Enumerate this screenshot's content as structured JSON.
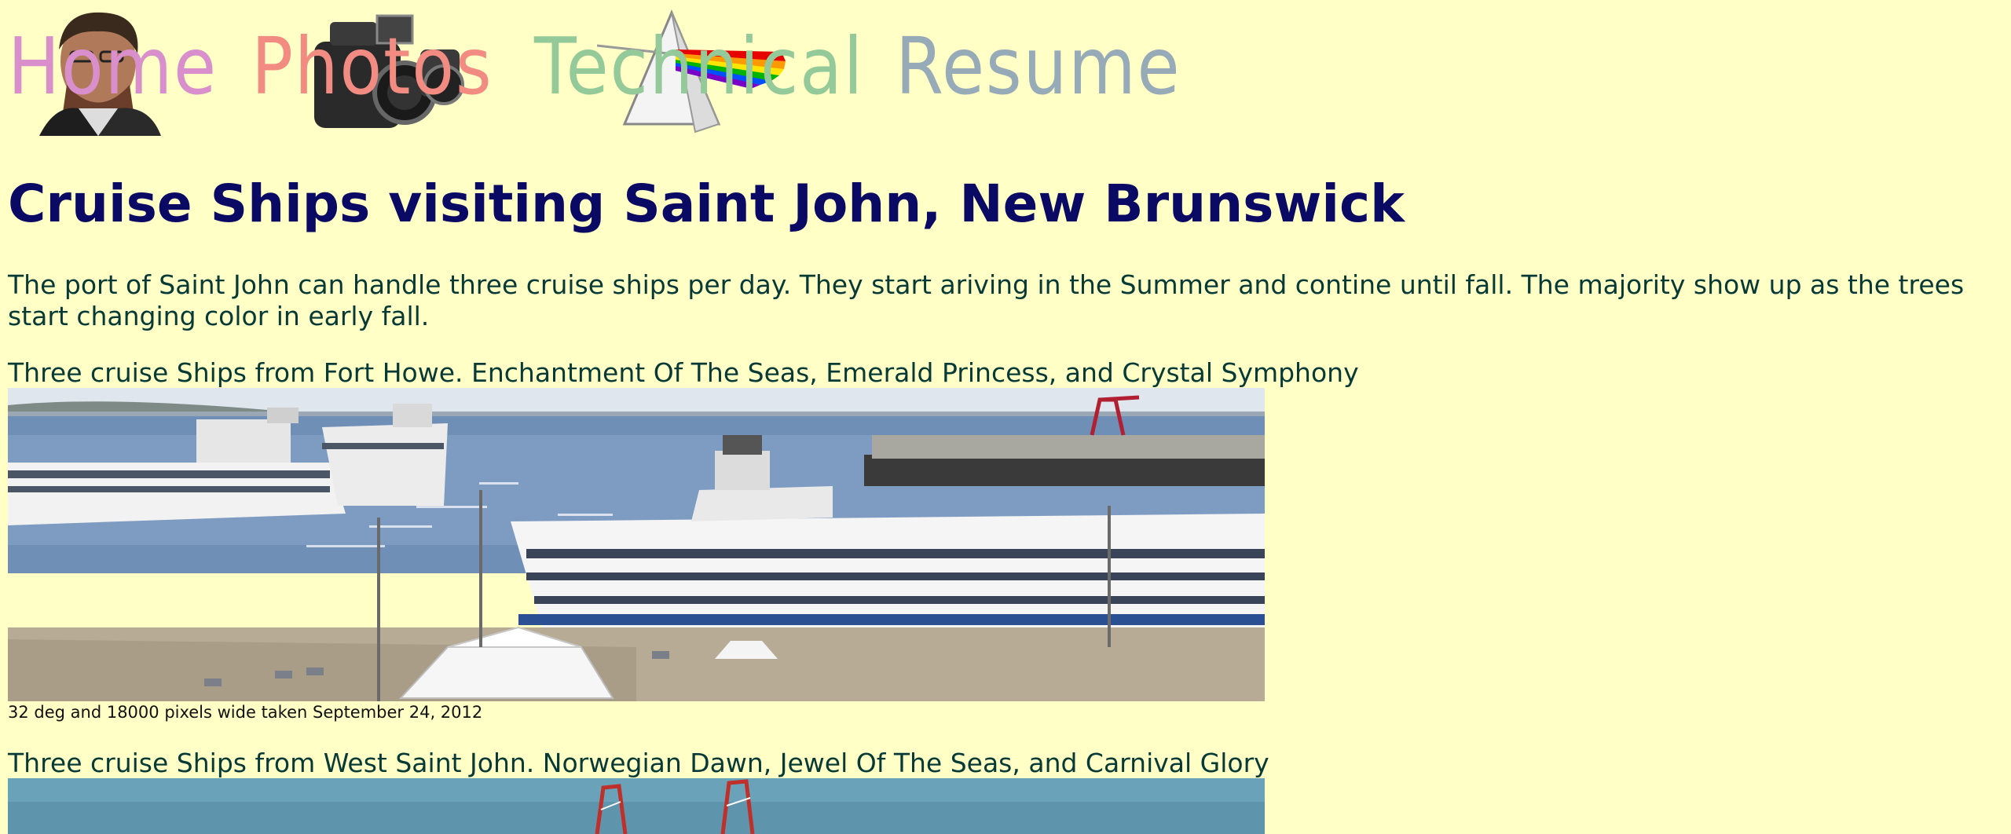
{
  "nav": {
    "items": [
      {
        "label": "Home",
        "icon": "portrait-icon",
        "color": "#d98fcb"
      },
      {
        "label": "Photos",
        "icon": "camera-icon",
        "color": "#f28c83"
      },
      {
        "label": "Technical",
        "icon": "prism-icon",
        "color": "#94c99a"
      },
      {
        "label": "Resume",
        "icon": "",
        "color": "#96aab8"
      }
    ]
  },
  "page": {
    "title": "Cruise Ships visiting Saint John, New Brunswick",
    "intro": "The port of Saint John can handle three cruise ships per day. They start ariving in the Summer and contine until fall. The majority show up as the trees start changing color in early fall."
  },
  "sections": [
    {
      "title": "Three cruise Ships from Fort Howe. Enchantment Of The Seas, Emerald Princess, and Crystal Symphony",
      "caption": "32 deg and 18000 pixels wide taken September 24, 2012"
    },
    {
      "title": "Three cruise Ships from West Saint John. Norwegian Dawn, Jewel Of The Seas, and Carnival Glory",
      "caption": ""
    }
  ],
  "colors": {
    "background": "#ffffc6",
    "title": "#0a0a64",
    "text": "#073a36"
  }
}
